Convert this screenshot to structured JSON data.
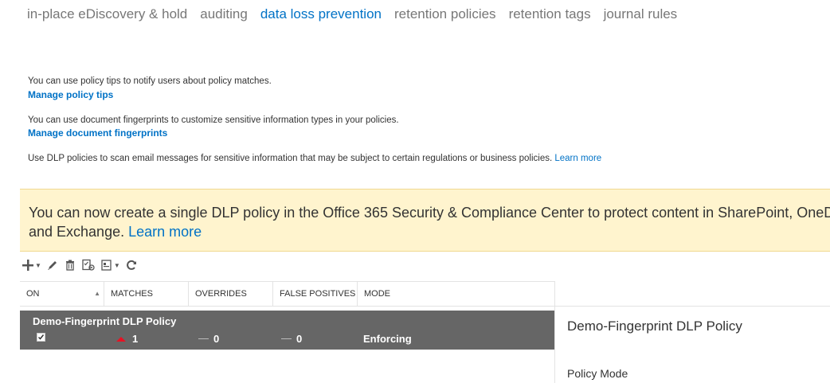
{
  "nav": {
    "tabs": [
      {
        "label": "in-place eDiscovery & hold",
        "active": false
      },
      {
        "label": "auditing",
        "active": false
      },
      {
        "label": "data loss prevention",
        "active": true
      },
      {
        "label": "retention policies",
        "active": false
      },
      {
        "label": "retention tags",
        "active": false
      },
      {
        "label": "journal rules",
        "active": false
      }
    ]
  },
  "info": {
    "policy_tips_text": "You can use policy tips to notify users about policy matches.",
    "policy_tips_link": "Manage policy tips",
    "fingerprints_text": "You can use document fingerprints to customize sensitive information types in your policies.",
    "fingerprints_link": "Manage document fingerprints",
    "dlp_text": "Use DLP policies to scan email messages for sensitive information that may be subject to certain regulations or business policies.",
    "dlp_learn_more": "Learn more"
  },
  "banner": {
    "text": "You can now create a single DLP policy in the Office 365 Security & Compliance Center to protect content in SharePoint, OneDrive, and Exchange.",
    "link": "Learn more",
    "color": "#fff4ce"
  },
  "toolbar": {
    "icons": [
      "add-icon",
      "edit-icon",
      "delete-icon",
      "manage-icon",
      "export-icon",
      "refresh-icon"
    ]
  },
  "grid": {
    "columns": [
      "ON",
      "MATCHES",
      "OVERRIDES",
      "FALSE POSITIVES",
      "MODE"
    ],
    "rows": [
      {
        "name": "Demo-Fingerprint DLP Policy",
        "on": true,
        "matches": "1",
        "overrides": "0",
        "false_positives": "0",
        "mode": "Enforcing"
      }
    ]
  },
  "detail": {
    "title": "Demo-Fingerprint DLP Policy",
    "policy_mode_label": "Policy Mode"
  },
  "colors": {
    "accent": "#0072c6",
    "selected_row": "#666666",
    "alert_red": "#e81123"
  }
}
